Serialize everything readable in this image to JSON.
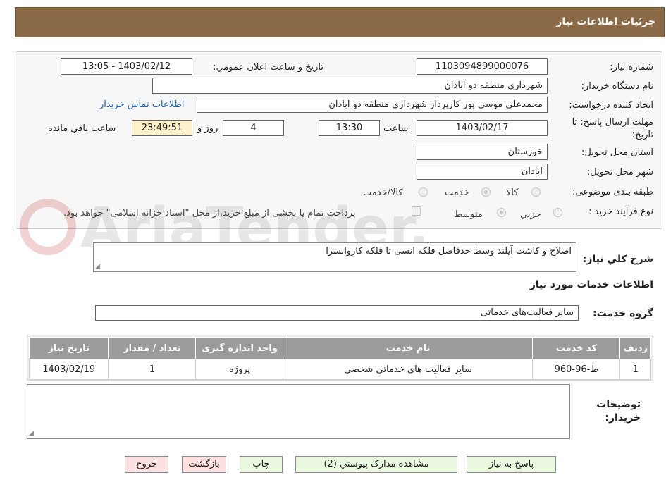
{
  "header": {
    "title": "جزئیات اطلاعات نیاز"
  },
  "labels": {
    "need_number": "شماره نیاز:",
    "announce_datetime": "تاريخ و ساعت اعلان عمومي:",
    "buyer_org": "نام دستگاه خريدار:",
    "requester": "ايجاد کننده درخواست:",
    "deadline_line1": "مهلت ارسال پاسخ: تا",
    "deadline_line2": "تاریخ:",
    "time": "ساعت",
    "days_and": "روز و",
    "hours_remaining": "ساعت باقي مانده",
    "province": "استان محل تحويل:",
    "city": "شهر محل تحويل:",
    "category": "طبقه بندی موضوعی:",
    "process": "نوع فرآيند خريد :",
    "general_desc": "شرح کلي نياز:",
    "services_info": "اطلاعات خدمات مورد نياز",
    "service_group": "گروه خدمت:",
    "buyer_notes_line1": "توضيحات",
    "buyer_notes_line2": "خريدار:"
  },
  "values": {
    "need_number": "1103094899000076",
    "announce_datetime": "1403/02/12 - 13:05",
    "buyer_org": "شهرداری منطقه دو آبادان",
    "requester": "محمدعلی موسی پور کارپرداز شهرداری منطقه دو آبادان",
    "contact_link": "اطلاعات تماس خريدار",
    "deadline_date": "1403/02/17",
    "deadline_time": "13:30",
    "days": "4",
    "remaining": "23:49:51",
    "province": "خوزستان",
    "city": "آبادان",
    "general_desc": "اصلاح و کاشت آیلند وسط حدفاصل فلکه انسی تا فلکه کاروانسرا",
    "service_group": "سایر فعالیت‌های خدماتی",
    "buyer_notes": ""
  },
  "category_options": [
    "کالا",
    "خدمت",
    "کالا/خدمت"
  ],
  "category_selected": "خدمت",
  "process_options": [
    "جزيي",
    "متوسط"
  ],
  "process_selected": "متوسط",
  "payment_note": "پرداخت تمام یا بخشی از مبلغ خرید،از محل \"اسناد خزانه اسلامی\" خواهد بود.",
  "watermark_text": "AriaTender.neT",
  "table": {
    "headers": [
      "رديف",
      "کد خدمت",
      "نام خدمت",
      "واحد اندازه گيری",
      "تعداد / مقدار",
      "تاريخ نياز"
    ],
    "rows": [
      [
        "1",
        "ط-96-960",
        "سایر فعالیت های خدماتی شخصی",
        "پروژه",
        "1",
        "1403/02/19"
      ]
    ]
  },
  "buttons": {
    "reply": "پاسخ به نياز",
    "attachments": "مشاهده مدارک پيوستي (2)",
    "print": "چاپ",
    "back": "بازگشت",
    "exit": "خروج"
  }
}
